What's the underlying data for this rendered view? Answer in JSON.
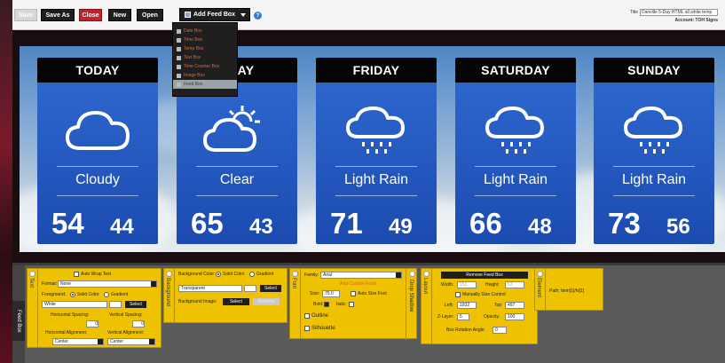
{
  "toolbar": {
    "save": "Save",
    "save_as": "Save As",
    "close": "Close",
    "new": "New",
    "open": "Open",
    "add_feed_box": "Add Feed Box",
    "help": "?"
  },
  "dropdown": {
    "items": [
      "Date Box",
      "Time Box",
      "Temp Box",
      "Text Box",
      "Time Counter Box",
      "Image Box",
      "Feed Box"
    ]
  },
  "header": {
    "title_label": "Title",
    "title_value": "Danville 5-Day HTML all white temp",
    "account": "Account: TOH Signs"
  },
  "forecast": [
    {
      "day": "TODAY",
      "condition": "Cloudy",
      "high": "54",
      "low": "44",
      "icon": "cloud-icon"
    },
    {
      "day": "SDAY",
      "condition": "Clear",
      "high": "65",
      "low": "43",
      "icon": "partly-sunny-icon"
    },
    {
      "day": "FRIDAY",
      "condition": "Light Rain",
      "high": "71",
      "low": "49",
      "icon": "rain-cloud-icon"
    },
    {
      "day": "SATURDAY",
      "condition": "Light Rain",
      "high": "66",
      "low": "48",
      "icon": "rain-cloud-icon"
    },
    {
      "day": "SUNDAY",
      "condition": "Light Rain",
      "high": "73",
      "low": "56",
      "icon": "rain-cloud-icon"
    }
  ],
  "side_tabs": [
    "Feed Box"
  ],
  "text_panel": {
    "label": "Text",
    "auto_wrap": "Auto Wrap Text",
    "format_label": "Format:",
    "format_value": "None",
    "foreground_label": "Foreground:",
    "solid": "Solid Color",
    "gradient": "Gradient",
    "fg_value": "White",
    "select": "Select",
    "h_spacing": "Horizontal Spacing:",
    "v_spacing": "Vertical Spacing:",
    "h_spacing_value": "0",
    "v_spacing_value": "0",
    "h_align": "Horizontal Alignment:",
    "v_align": "Vertical Alignment:",
    "h_align_value": "Center",
    "v_align_value": "Center"
  },
  "background_panel": {
    "label": "Background",
    "bg_color": "Background Color:",
    "solid": "Solid Color",
    "gradient": "Gradient",
    "bg_value": "Transparent",
    "select": "Select",
    "bg_image": "Background Image:",
    "remove": "Remove"
  },
  "font_panel": {
    "label": "Font",
    "family": "Family:",
    "family_value": "Arial",
    "add_custom": "Add Custom Fonts",
    "size": "Size:",
    "size_value": "75.0",
    "auto_size": "Auto Size Font",
    "bold": "Bold:",
    "italic": "Italic:",
    "outline": "Outline",
    "silhouette": "Silhouette",
    "drop_shadow": "Drop Shadow"
  },
  "layout_panel": {
    "label": "Layout",
    "remove": "Remove Feed Box",
    "width": "Width:",
    "width_value": "151",
    "height": "Height:",
    "height_value": "53",
    "manual": "Manually Size Control",
    "left": "Left:",
    "left_value": "1932",
    "top": "Top:",
    "top_value": "497",
    "zlayer": "Z-Layer:",
    "zlayer_value": "5",
    "opacity": "Opacity:",
    "opacity_value": "100",
    "rotation": "Box Rotation Angle:",
    "rotation_value": "0"
  },
  "element_panel": {
    "label": "Element",
    "path": "Path: Item[1]/hi[1]"
  },
  "colors": {
    "accent": "#eec200",
    "close": "#c2202c",
    "card": "#2f6ad2"
  }
}
